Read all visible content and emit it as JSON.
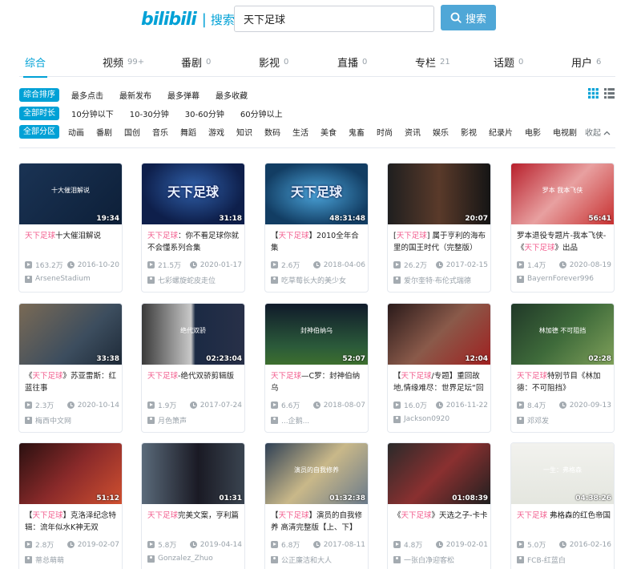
{
  "header": {
    "logo": "bilibili",
    "logo_sub": "搜索",
    "search_value": "天下足球",
    "search_button": "搜索"
  },
  "tabs": [
    {
      "label": "综合",
      "count": ""
    },
    {
      "label": "视频",
      "count": "99+"
    },
    {
      "label": "番剧",
      "count": "0"
    },
    {
      "label": "影视",
      "count": "0"
    },
    {
      "label": "直播",
      "count": "0"
    },
    {
      "label": "专栏",
      "count": "21"
    },
    {
      "label": "话题",
      "count": "0"
    },
    {
      "label": "用户",
      "count": "6"
    }
  ],
  "filters": {
    "order": {
      "label": "综合排序",
      "items": [
        "最多点击",
        "最新发布",
        "最多弹幕",
        "最多收藏"
      ]
    },
    "duration": {
      "label": "全部时长",
      "items": [
        "10分钟以下",
        "10-30分钟",
        "30-60分钟",
        "60分钟以上"
      ]
    },
    "zone": {
      "label": "全部分区",
      "items": [
        "动画",
        "番剧",
        "国创",
        "音乐",
        "舞蹈",
        "游戏",
        "知识",
        "数码",
        "生活",
        "美食",
        "鬼畜",
        "时尚",
        "资讯",
        "娱乐",
        "影视",
        "纪录片",
        "电影",
        "电视剧"
      ],
      "collapse": "收起"
    }
  },
  "videos": [
    {
      "kw": "天下足球",
      "rest": "十大催泪解说",
      "duration": "19:34",
      "views": "163.2万",
      "date": "2016-10-20",
      "uploader": "ArseneStadium",
      "thumb_text": "十大催泪解说"
    },
    {
      "kw": "天下足球",
      "rest": "：你不看足球你就不会懂系列合集",
      "duration": "31:18",
      "views": "21.5万",
      "date": "2020-01-17",
      "uploader": "七彩螺旋蛇皮走位",
      "thumb_text": "天下足球"
    },
    {
      "pre": "【",
      "kw": "天下足球",
      "rest": "】2010全年合集",
      "duration": "48:31:48",
      "views": "2.6万",
      "date": "2018-04-06",
      "uploader": "吃草莓长大的美少女",
      "thumb_text": "天下足球"
    },
    {
      "pre": "[",
      "kw": "天下足球",
      "rest": "] 属于亨利的海布里的国王时代（完整版）",
      "duration": "20:07",
      "views": "26.2万",
      "date": "2017-02-15",
      "uploader": "爱尔奎特·布伦式瑞德"
    },
    {
      "pre": "罗本退役专题片-我本飞侠-《",
      "kw": "天下足球",
      "rest": "》出品",
      "duration": "56:41",
      "views": "1.4万",
      "date": "2020-08-19",
      "uploader": "BayernForever996",
      "thumb_text": "罗本 我本飞侠"
    },
    {
      "pre": "《",
      "kw": "天下足球",
      "rest": "》苏亚雷斯：红蓝往事",
      "duration": "33:38",
      "views": "2.3万",
      "date": "2020-10-14",
      "uploader": "梅西中文网"
    },
    {
      "kw": "天下足球",
      "rest": "-绝代双骄剪辑版",
      "duration": "02:23:04",
      "views": "1.9万",
      "date": "2017-07-24",
      "uploader": "月色箫声",
      "thumb_text": "绝代双骄"
    },
    {
      "kw": "天下足球",
      "rest": "—C罗：封神伯纳乌",
      "duration": "52:07",
      "views": "6.6万",
      "date": "2018-08-07",
      "uploader": "...企鹅...",
      "thumb_text": "封神伯纳乌"
    },
    {
      "pre": "【",
      "kw": "天下足球",
      "rest": "/专题】重回故地,情缘难尽：世界足坛“回",
      "duration": "12:04",
      "views": "16.0万",
      "date": "2016-11-22",
      "uploader": "Jackson0920"
    },
    {
      "kw": "天下足球",
      "rest": "特别节目《林加德：不可阻挡》",
      "duration": "02:28",
      "views": "8.4万",
      "date": "2020-09-13",
      "uploader": "邓邓发",
      "thumb_text": "林加德 不可阻挡"
    },
    {
      "pre": "【",
      "kw": "天下足球",
      "rest": "】克洛泽纪念特辑：流年似水K神无双",
      "duration": "51:12",
      "views": "2.8万",
      "date": "2019-02-07",
      "uploader": "蒂总萌萌"
    },
    {
      "kw": "天下足球",
      "rest": "完美文案，亨利篇",
      "duration": "01:31",
      "views": "5.8万",
      "date": "2019-04-14",
      "uploader": "Gonzalez_Zhuo"
    },
    {
      "pre": "【",
      "kw": "天下足球",
      "rest": "】演员的自我修养 高清完整版【上、下】",
      "duration": "01:32:38",
      "views": "6.8万",
      "date": "2017-08-11",
      "uploader": "公正廉洁和大人",
      "thumb_text": "演员的自我修养"
    },
    {
      "pre": "《",
      "kw": "天下足球",
      "rest": "》天选之子-卡卡",
      "duration": "01:08:39",
      "views": "4.8万",
      "date": "2019-02-01",
      "uploader": "一张白净迎客松"
    },
    {
      "kw": "天下足球",
      "rest": " 弗格森的红色帝国",
      "duration": "04:38:26",
      "views": "5.0万",
      "date": "2016-02-16",
      "uploader": "FCB-红蓝白",
      "thumb_text": "一生：弗格森"
    }
  ]
}
